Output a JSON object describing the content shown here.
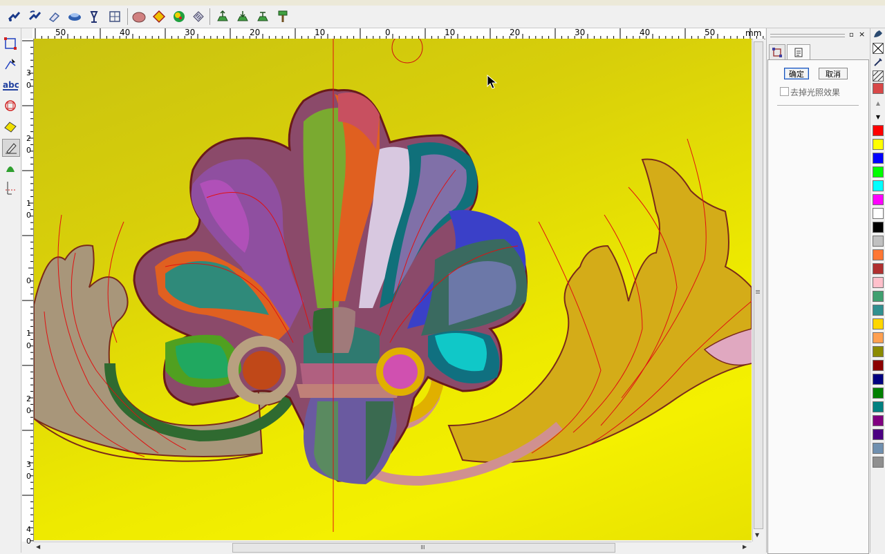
{
  "ruler": {
    "unit": "mm",
    "h_labels": [
      "50",
      "40",
      "30",
      "20",
      "10",
      "0",
      "10",
      "20",
      "30",
      "40",
      "50"
    ],
    "v_labels": [
      {
        "d1": "3",
        "d2": "0"
      },
      {
        "d1": "2",
        "d2": "0"
      },
      {
        "d1": "1",
        "d2": "0"
      },
      {
        "d1": "",
        "d2": "0"
      },
      {
        "d1": "1",
        "d2": "0"
      },
      {
        "d1": "2",
        "d2": "0"
      },
      {
        "d1": "3",
        "d2": "0"
      },
      {
        "d1": "4",
        "d2": "0"
      }
    ]
  },
  "panel": {
    "ok_label": "确定",
    "cancel_label": "取消",
    "light_checkbox_label": "去掉光照效果",
    "light_checkbox_checked": false
  },
  "toolbar": {
    "icons": [
      "move-node-icon",
      "rotate-node-icon",
      "eraser-icon",
      "smooth-icon",
      "clamp-icon",
      "relief-grid-icon",
      "sculpt-icon",
      "diamond-node-icon",
      "ball-icon",
      "diagonal-hatch-icon",
      "lift-icon",
      "push-icon",
      "raise-icon",
      "paint-brush-icon"
    ]
  },
  "left_tools": {
    "icons": [
      "select-rect-icon",
      "node-edit-icon",
      "text-tool-icon",
      "shape-tool-icon",
      "eraser-tool-icon",
      "pen-tool-icon",
      "bell-shape-icon",
      "measure-icon"
    ]
  },
  "palette_colors": [
    "#ff0000",
    "#ffff00",
    "#0000ff",
    "#00ff00",
    "#00ffff",
    "#ff00ff",
    "#ffffff",
    "#000000",
    "#c0c0c0",
    "#ff7733",
    "#b03030",
    "#ffc0cb",
    "#40a070",
    "#309090",
    "#ffd700",
    "#ffa050",
    "#8b8b00",
    "#8b0000",
    "#000080",
    "#008000",
    "#008080",
    "#800080",
    "#4b0082",
    "#7090b0",
    "#909090"
  ],
  "colors": {
    "canvas_bg": "#dcd40a",
    "accent_red_line": "#e01010"
  }
}
